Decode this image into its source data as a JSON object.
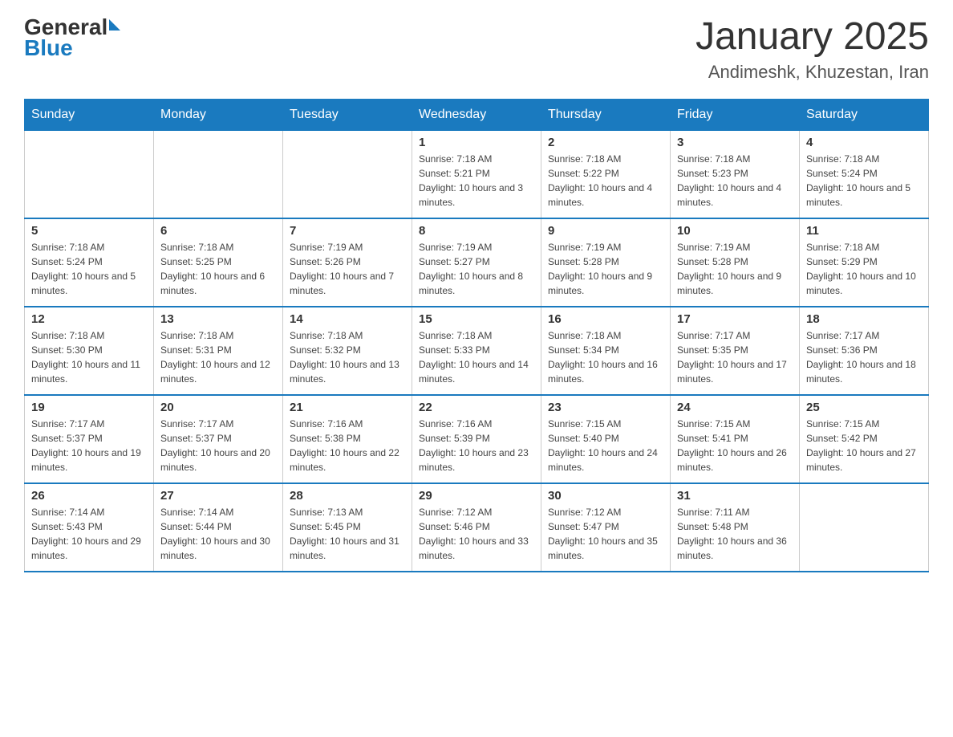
{
  "logo": {
    "general": "General",
    "blue": "Blue"
  },
  "title": "January 2025",
  "subtitle": "Andimeshk, Khuzestan, Iran",
  "days_of_week": [
    "Sunday",
    "Monday",
    "Tuesday",
    "Wednesday",
    "Thursday",
    "Friday",
    "Saturday"
  ],
  "weeks": [
    [
      {
        "day": "",
        "info": ""
      },
      {
        "day": "",
        "info": ""
      },
      {
        "day": "",
        "info": ""
      },
      {
        "day": "1",
        "info": "Sunrise: 7:18 AM\nSunset: 5:21 PM\nDaylight: 10 hours and 3 minutes."
      },
      {
        "day": "2",
        "info": "Sunrise: 7:18 AM\nSunset: 5:22 PM\nDaylight: 10 hours and 4 minutes."
      },
      {
        "day": "3",
        "info": "Sunrise: 7:18 AM\nSunset: 5:23 PM\nDaylight: 10 hours and 4 minutes."
      },
      {
        "day": "4",
        "info": "Sunrise: 7:18 AM\nSunset: 5:24 PM\nDaylight: 10 hours and 5 minutes."
      }
    ],
    [
      {
        "day": "5",
        "info": "Sunrise: 7:18 AM\nSunset: 5:24 PM\nDaylight: 10 hours and 5 minutes."
      },
      {
        "day": "6",
        "info": "Sunrise: 7:18 AM\nSunset: 5:25 PM\nDaylight: 10 hours and 6 minutes."
      },
      {
        "day": "7",
        "info": "Sunrise: 7:19 AM\nSunset: 5:26 PM\nDaylight: 10 hours and 7 minutes."
      },
      {
        "day": "8",
        "info": "Sunrise: 7:19 AM\nSunset: 5:27 PM\nDaylight: 10 hours and 8 minutes."
      },
      {
        "day": "9",
        "info": "Sunrise: 7:19 AM\nSunset: 5:28 PM\nDaylight: 10 hours and 9 minutes."
      },
      {
        "day": "10",
        "info": "Sunrise: 7:19 AM\nSunset: 5:28 PM\nDaylight: 10 hours and 9 minutes."
      },
      {
        "day": "11",
        "info": "Sunrise: 7:18 AM\nSunset: 5:29 PM\nDaylight: 10 hours and 10 minutes."
      }
    ],
    [
      {
        "day": "12",
        "info": "Sunrise: 7:18 AM\nSunset: 5:30 PM\nDaylight: 10 hours and 11 minutes."
      },
      {
        "day": "13",
        "info": "Sunrise: 7:18 AM\nSunset: 5:31 PM\nDaylight: 10 hours and 12 minutes."
      },
      {
        "day": "14",
        "info": "Sunrise: 7:18 AM\nSunset: 5:32 PM\nDaylight: 10 hours and 13 minutes."
      },
      {
        "day": "15",
        "info": "Sunrise: 7:18 AM\nSunset: 5:33 PM\nDaylight: 10 hours and 14 minutes."
      },
      {
        "day": "16",
        "info": "Sunrise: 7:18 AM\nSunset: 5:34 PM\nDaylight: 10 hours and 16 minutes."
      },
      {
        "day": "17",
        "info": "Sunrise: 7:17 AM\nSunset: 5:35 PM\nDaylight: 10 hours and 17 minutes."
      },
      {
        "day": "18",
        "info": "Sunrise: 7:17 AM\nSunset: 5:36 PM\nDaylight: 10 hours and 18 minutes."
      }
    ],
    [
      {
        "day": "19",
        "info": "Sunrise: 7:17 AM\nSunset: 5:37 PM\nDaylight: 10 hours and 19 minutes."
      },
      {
        "day": "20",
        "info": "Sunrise: 7:17 AM\nSunset: 5:37 PM\nDaylight: 10 hours and 20 minutes."
      },
      {
        "day": "21",
        "info": "Sunrise: 7:16 AM\nSunset: 5:38 PM\nDaylight: 10 hours and 22 minutes."
      },
      {
        "day": "22",
        "info": "Sunrise: 7:16 AM\nSunset: 5:39 PM\nDaylight: 10 hours and 23 minutes."
      },
      {
        "day": "23",
        "info": "Sunrise: 7:15 AM\nSunset: 5:40 PM\nDaylight: 10 hours and 24 minutes."
      },
      {
        "day": "24",
        "info": "Sunrise: 7:15 AM\nSunset: 5:41 PM\nDaylight: 10 hours and 26 minutes."
      },
      {
        "day": "25",
        "info": "Sunrise: 7:15 AM\nSunset: 5:42 PM\nDaylight: 10 hours and 27 minutes."
      }
    ],
    [
      {
        "day": "26",
        "info": "Sunrise: 7:14 AM\nSunset: 5:43 PM\nDaylight: 10 hours and 29 minutes."
      },
      {
        "day": "27",
        "info": "Sunrise: 7:14 AM\nSunset: 5:44 PM\nDaylight: 10 hours and 30 minutes."
      },
      {
        "day": "28",
        "info": "Sunrise: 7:13 AM\nSunset: 5:45 PM\nDaylight: 10 hours and 31 minutes."
      },
      {
        "day": "29",
        "info": "Sunrise: 7:12 AM\nSunset: 5:46 PM\nDaylight: 10 hours and 33 minutes."
      },
      {
        "day": "30",
        "info": "Sunrise: 7:12 AM\nSunset: 5:47 PM\nDaylight: 10 hours and 35 minutes."
      },
      {
        "day": "31",
        "info": "Sunrise: 7:11 AM\nSunset: 5:48 PM\nDaylight: 10 hours and 36 minutes."
      },
      {
        "day": "",
        "info": ""
      }
    ]
  ]
}
